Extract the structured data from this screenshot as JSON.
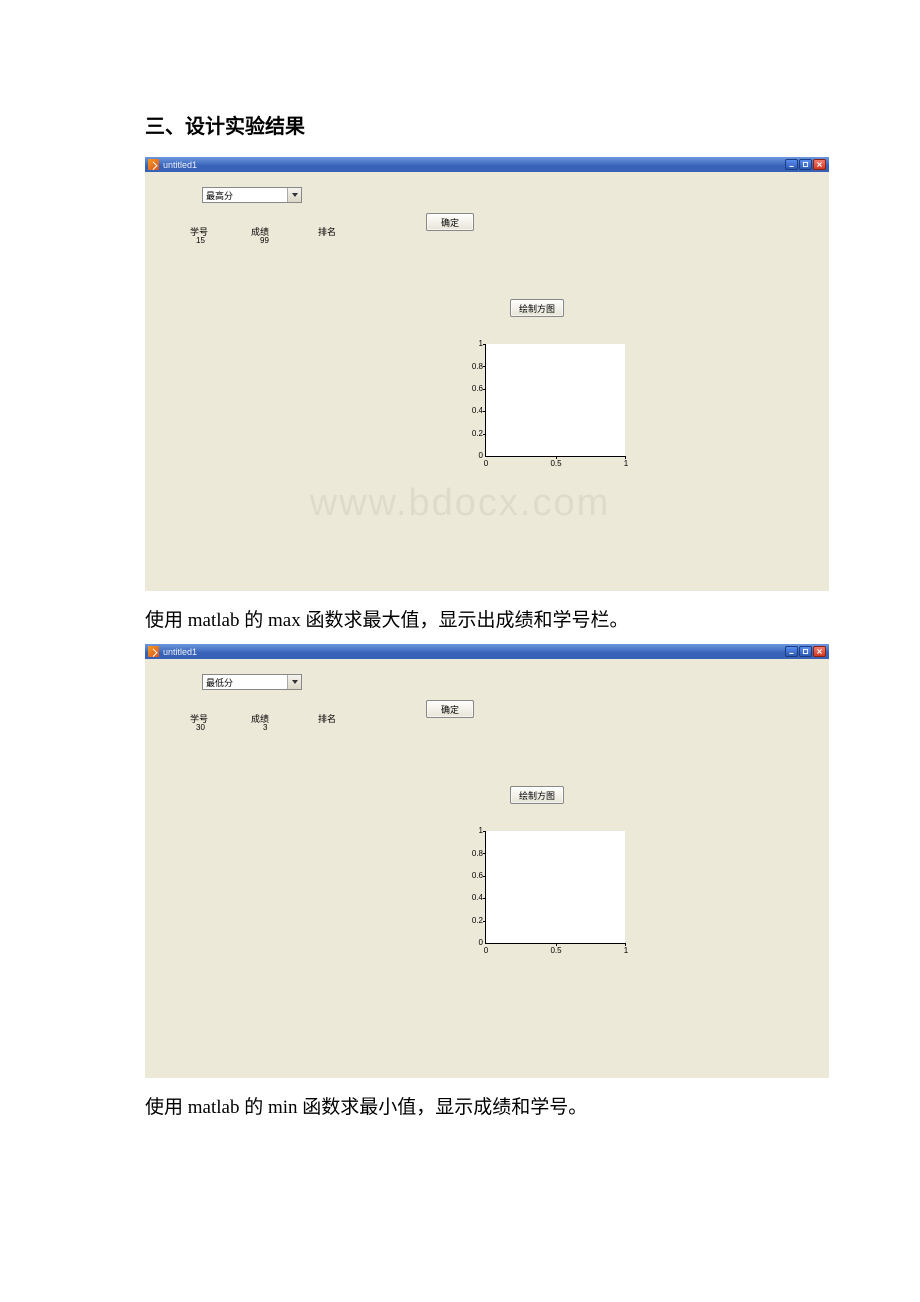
{
  "heading": "三、设计实验结果",
  "caption1_parts": {
    "pre": "使用 ",
    "mat": "matlab ",
    "mid": "的 ",
    "fn": "max ",
    "post": "函数求最大值，显示出成绩和学号栏。"
  },
  "caption2_parts": {
    "pre": "使用 ",
    "mat": "matlab ",
    "mid": "的 ",
    "fn": "min ",
    "post": "函数求最小值，显示成绩和学号。"
  },
  "watermark": "www.bdocx.com",
  "gui_common": {
    "title": "untitled1",
    "labels": {
      "id": "学号",
      "score": "成绩",
      "rank": "排名"
    },
    "btn_confirm": "确定",
    "btn_plot": "绘制方图",
    "yticks": [
      "1",
      "0.8",
      "0.6",
      "0.4",
      "0.2",
      "0"
    ],
    "xticks": [
      "0",
      "0.5",
      "1"
    ]
  },
  "gui1": {
    "dropdown": "最高分",
    "id_val": "15",
    "score_val": "99",
    "rank_val": ""
  },
  "gui2": {
    "dropdown": "最低分",
    "id_val": "30",
    "score_val": "3",
    "rank_val": ""
  }
}
